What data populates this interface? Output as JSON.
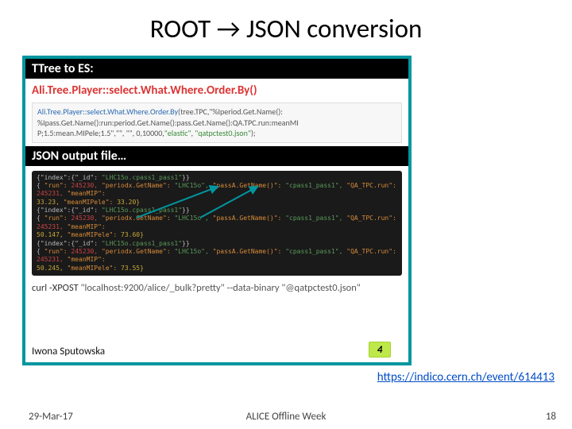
{
  "title": "ROOT → JSON conversion",
  "inner": {
    "ttree_header": "TTree to ES:",
    "method": "Ali.Tree.Player::select.What.Where.Order.By()",
    "code1_a": "Ali.Tree.Player::select.What.Where.Order.By",
    "code1_b": "(tree.TPC,\"%Iperiod.Get.Name():",
    "code1_c": "%Ipass.Get.Name():run:period.Get.Name():pass.Get.Name():QA.TPC.run:meanMI",
    "code1_d": "P;1.5:mean.MIPele;1.5\",\"\", \"\", 0,10000,",
    "code1_e": "\"elastic\"",
    "code1_f": ",",
    "code1_g": "\"qatpctest0.json\"",
    "code1_h": ");",
    "json_header": "JSON output file…",
    "code2_l1a": "{\"index\":{\"_id\":",
    "code2_l1b": "\"LHC15o.cpass1_pass1\"",
    "code2_l1c": "}}",
    "code2_l2a": "{",
    "code2_l2b": "\"run\":",
    "code2_l2c": "245230,",
    "code2_l2d": "\"periodx.GetName\":",
    "code2_l2e": "\"LHC15o\",",
    "code2_l2f": "\"passA.GetName()\":",
    "code2_l2g": "\"cpass1_pass1\",",
    "code2_l2h": "\"QA_TPC.run\":",
    "code2_l2i": "245231,",
    "code2_l2j": "\"meanMIP\":",
    "code2_l3a": "33.23,",
    "code2_l3b": "\"meanMIPele\":",
    "code2_l3c": "33.20}",
    "code2_l4a": "{\"index\":{\"_id\":",
    "code2_l4b": "\"LHC15o.cpass1_pass1\"",
    "code2_l4c": "}}",
    "code2_l5a": "{",
    "code2_l5b": "\"run\":",
    "code2_l5c": "245230,",
    "code2_l5d": "\"periodx.GetName\":",
    "code2_l5e": "\"LHC15o\",",
    "code2_l5f": "\"passA.GetName()\":",
    "code2_l5g": "\"cpass1_pass1\",",
    "code2_l5h": "\"QA_TPC.run\":",
    "code2_l5i": "245231,",
    "code2_l5j": "\"meanMIP\":",
    "code2_l6a": "50.147,",
    "code2_l6b": "\"meanMIPele\":",
    "code2_l6c": "73.60}",
    "code2_l7a": "{\"index\":{\"_id\":",
    "code2_l7b": "\"LHC15o.cpass1_pass1\"",
    "code2_l7c": "}}",
    "code2_l8a": "{",
    "code2_l8b": "\"run\":",
    "code2_l8c": "245230,",
    "code2_l8d": "\"periodx.GetName\":",
    "code2_l8e": "\"LHC15o\",",
    "code2_l8f": "\"passA.GetName()\":",
    "code2_l8g": "\"cpass1_pass1\",",
    "code2_l8h": "\"QA_TPC.run\":",
    "code2_l8i": "245231,",
    "code2_l8j": "\"meanMIP\":",
    "code2_l9a": "50.245,",
    "code2_l9b": "\"meanMIPele\":",
    "code2_l9c": "73.55}",
    "curl_a": "curl -XPOST ",
    "curl_b": "\"localhost:9200/alice/_bulk?pretty\" --data-binary \"@qatpctest0.json\"",
    "speaker": "Iwona Sputowska",
    "inner_page": "4"
  },
  "link_text": "https://indico.cern.ch/event/614413",
  "link_href": "https://indico.cern.ch/event/614413",
  "footer": {
    "date": "29-Mar-17",
    "center": "ALICE Offline Week",
    "page": "18"
  }
}
